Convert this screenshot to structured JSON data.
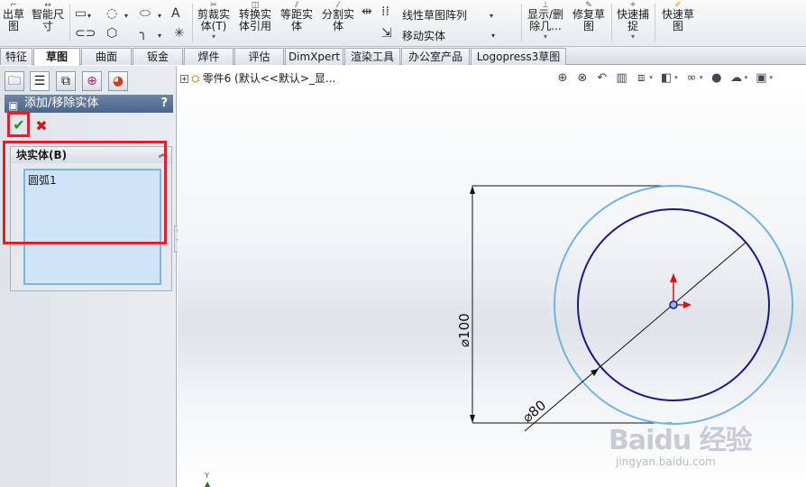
{
  "ribbon": {
    "exit_sketch": "出草\n图",
    "smart_dim": "智能尺\n寸",
    "trim": "剪裁实\n体(T)",
    "convert": "转换实\n体引用",
    "offset": "等距实\n体",
    "split": "分割实\n体",
    "linear_pattern": "线性草图阵列",
    "move": "移动实体",
    "display_delete": "显示/删\n除几...",
    "repair": "修复草\n图",
    "quick_snap": "快速捕\n捉",
    "rapid_sketch": "快速草\n图"
  },
  "tabs": [
    "特征",
    "草图",
    "曲面",
    "钣金",
    "焊件",
    "评估",
    "DimXpert",
    "渲染工具",
    "办公室产品",
    "Logopress3草图"
  ],
  "active_tab": "草图",
  "panel": {
    "title": "添加/移除实体",
    "help": "?",
    "group_title": "块实体(B)",
    "list_items": [
      "圆弧1"
    ]
  },
  "tree": {
    "root": "零件6 (默认<<默认>_显..."
  },
  "dims": {
    "d100": "⌀100",
    "d80": "⌀80"
  },
  "triad": "Y",
  "watermark": {
    "logo": "Baidu 经验",
    "sub": "jingyan.baidu.com"
  },
  "colors": {
    "outer_circle": "#6fb4e8",
    "inner_circle": "#1a1a8c",
    "dimension_line": "#111111",
    "highlight_box": "#e0202a",
    "selection_list": "#cfe4f8"
  }
}
